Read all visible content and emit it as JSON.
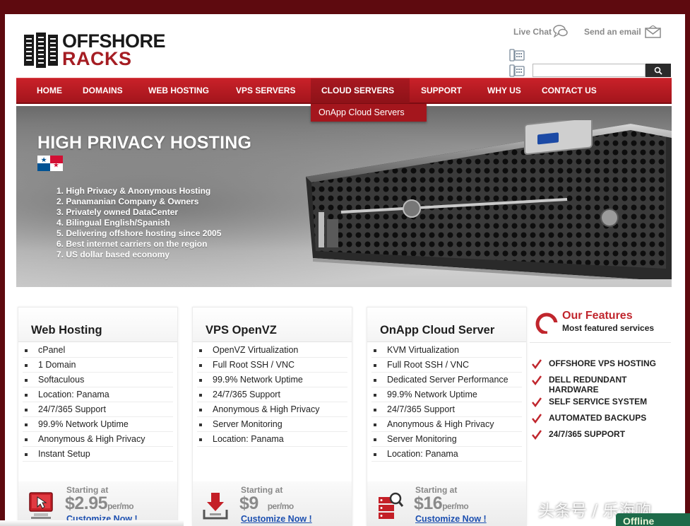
{
  "header": {
    "logo_line1": "OFFSHORE",
    "logo_line2": "RACKS",
    "live_chat": "Live Chat",
    "send_email": "Send an email",
    "search_placeholder": ""
  },
  "nav": {
    "items": [
      {
        "label": "HOME"
      },
      {
        "label": "DOMAINS"
      },
      {
        "label": "WEB HOSTING"
      },
      {
        "label": "VPS SERVERS"
      },
      {
        "label": "CLOUD SERVERS"
      },
      {
        "label": "SUPPORT"
      },
      {
        "label": "WHY US"
      },
      {
        "label": "CONTACT US"
      }
    ],
    "dropdown_item": "OnApp Cloud Servers"
  },
  "banner": {
    "title": "HIGH PRIVACY HOSTING",
    "items": [
      "1. High Privacy & Anonymous Hosting",
      "2. Panamanian Company & Owners",
      "3. Privately owned DataCenter",
      "4. Bilingual English/Spanish",
      "5. Delivering offshore hosting since 2005",
      "6. Best internet carriers on the region",
      "7. US dollar based economy"
    ]
  },
  "plans": [
    {
      "title": "Web Hosting",
      "features": [
        "cPanel",
        "1 Domain",
        "Softaculous",
        "Location: Panama",
        "24/7/365 Support",
        "99.9% Network Uptime",
        "Anonymous & High Privacy",
        "Instant Setup"
      ],
      "starting": "Starting at",
      "price": "$2.95",
      "per": "per/mo",
      "cta": "Customize Now !"
    },
    {
      "title": "VPS OpenVZ",
      "features": [
        "OpenVZ Virtualization",
        "Full Root SSH / VNC",
        "99.9% Network Uptime",
        "24/7/365 Support",
        "Anonymous & High Privacy",
        "Server Monitoring",
        "Location: Panama"
      ],
      "starting": "Starting at",
      "price": "$9",
      "per": "per/mo",
      "cta": "Customize Now !"
    },
    {
      "title": "OnApp Cloud Server",
      "features": [
        "KVM Virtualization",
        "Full Root SSH / VNC",
        "Dedicated Server Performance",
        "99.9% Network Uptime",
        "24/7/365 Support",
        "Anonymous & High Privacy",
        "Server Monitoring",
        "Location: Panama"
      ],
      "starting": "Starting at",
      "price": "$16",
      "per": "per/mo",
      "cta": "Customize Now !"
    }
  ],
  "features_panel": {
    "title": "Our Features",
    "subtitle": "Most featured services",
    "items": [
      "OFFSHORE VPS HOSTING",
      "DELL REDUNDANT HARDWARE",
      "SELF SERVICE SYSTEM",
      "AUTOMATED BACKUPS",
      "24/7/365 SUPPORT"
    ]
  },
  "overlay": {
    "watermark": "头条号 / 乐海购",
    "offline": "Offline"
  },
  "colors": {
    "brand_red": "#c0262d",
    "nav_red": "#b81c24",
    "link_blue": "#1c4fb0",
    "frame_dark_red": "#5e0a0f"
  }
}
